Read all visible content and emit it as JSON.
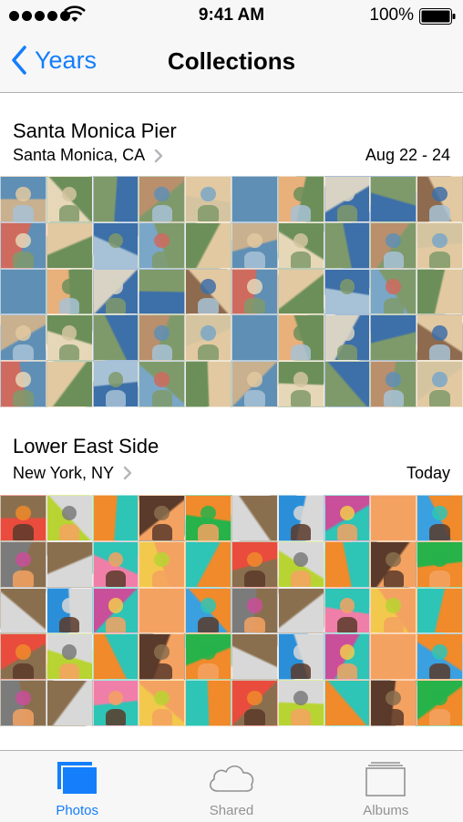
{
  "status_bar": {
    "time": "9:41 AM",
    "battery_percent": "100%",
    "signal_bars": 5
  },
  "nav": {
    "back_label": "Years",
    "title": "Collections"
  },
  "collections": [
    {
      "title": "Santa Monica Pier",
      "location": "Santa Monica, CA",
      "date": "Aug 22 - 24",
      "thumbnail_rows": 5,
      "palette": [
        "#c9b08f",
        "#7aa7c7",
        "#e2c9a1",
        "#8e6b4e",
        "#d8d3c4",
        "#5f8fb4",
        "#b98f6c",
        "#e6d7b8",
        "#6c8f5a",
        "#a7c2d6",
        "#cf6a5f",
        "#3d6fa8",
        "#e8b07a",
        "#d4c4a0",
        "#7f9a6a"
      ]
    },
    {
      "title": "Lower East Side",
      "location": "New York, NY",
      "date": "Today",
      "thumbnail_rows": 5,
      "palette": [
        "#2a8fd8",
        "#27b24a",
        "#f08a2a",
        "#e94c3c",
        "#f2c94c",
        "#8a6f4e",
        "#3aa0e0",
        "#c94f9a",
        "#d8d8d8",
        "#5a3a2a",
        "#b8d432",
        "#2ec4b6",
        "#ef7fa8",
        "#7b7b7b",
        "#f4a261"
      ]
    }
  ],
  "tab_bar": {
    "tabs": [
      {
        "label": "Photos",
        "icon": "photos-icon",
        "active": true
      },
      {
        "label": "Shared",
        "icon": "cloud-icon",
        "active": false
      },
      {
        "label": "Albums",
        "icon": "albums-icon",
        "active": false
      }
    ]
  },
  "colors": {
    "accent": "#147efb",
    "inactive_tab": "#929292",
    "bar_background": "#f7f7f7"
  }
}
